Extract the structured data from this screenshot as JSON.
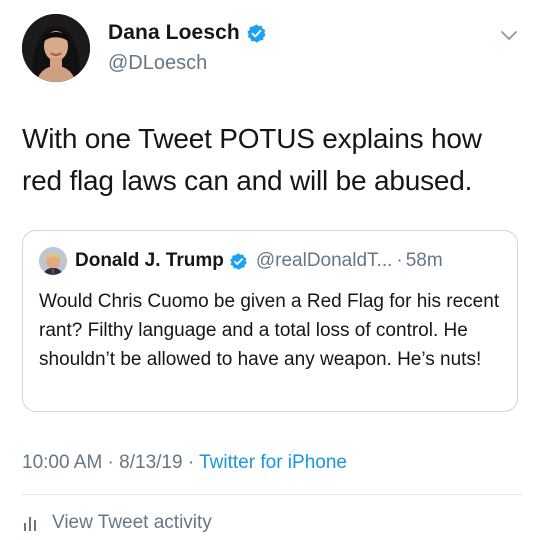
{
  "author": {
    "display_name": "Dana Loesch",
    "handle": "@DLoesch",
    "verified": true
  },
  "tweet": {
    "text": "With one Tweet POTUS explains how red flag laws can and will be abused."
  },
  "quoted_tweet": {
    "display_name": "Donald J. Trump",
    "handle": "@realDonaldT...",
    "separator": "·",
    "time": "58m",
    "verified": true,
    "text": "Would Chris Cuomo be given a Red Flag for his recent rant? Filthy language and a total loss of control. He shouldn’t be allowed to have any weapon. He’s nuts!"
  },
  "meta": {
    "time": "10:00 AM",
    "sep1": " · ",
    "date": "8/13/19",
    "sep2": " · ",
    "source": "Twitter for iPhone"
  },
  "activity": {
    "label": "View Tweet activity"
  },
  "colors": {
    "accent": "#1da1f2",
    "link": "#1b95e0",
    "secondary_text": "#657786",
    "border": "#ccd6dd"
  },
  "icons": {
    "verified": "verified-badge-icon",
    "menu": "chevron-down-icon",
    "activity": "bar-chart-icon"
  }
}
